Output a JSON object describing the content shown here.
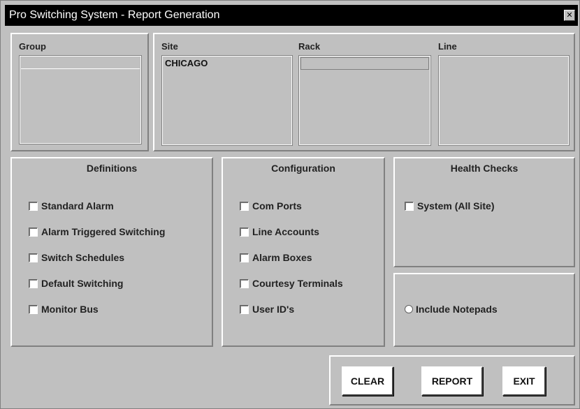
{
  "window": {
    "title": "Pro Switching System - Report Generation",
    "close_symbol": "✕"
  },
  "selectors": {
    "group": {
      "label": "Group",
      "items": []
    },
    "site": {
      "label": "Site",
      "items": [
        "CHICAGO"
      ]
    },
    "rack": {
      "label": "Rack",
      "items": []
    },
    "line": {
      "label": "Line",
      "items": []
    }
  },
  "definitions": {
    "heading": "Definitions",
    "options": [
      "Standard Alarm",
      "Alarm Triggered Switching",
      "Switch Schedules",
      "Default Switching",
      "Monitor Bus"
    ]
  },
  "configuration": {
    "heading": "Configuration",
    "options": [
      "Com Ports",
      "Line Accounts",
      "Alarm Boxes",
      "Courtesy Terminals",
      "User ID's"
    ]
  },
  "health_checks": {
    "heading": "Health Checks",
    "options": [
      "System (All Site)"
    ]
  },
  "notepads": {
    "label": "Include Notepads"
  },
  "buttons": {
    "clear": "CLEAR",
    "report": "REPORT",
    "exit": "EXIT"
  }
}
